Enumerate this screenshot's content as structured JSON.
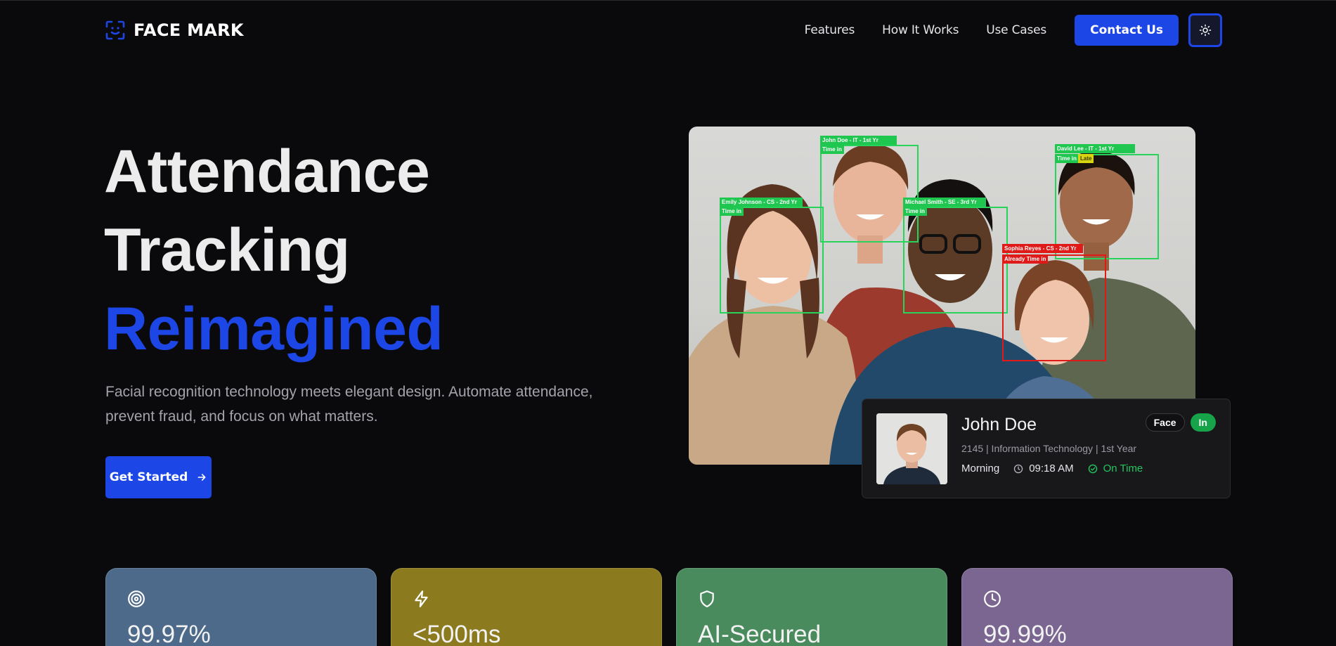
{
  "brand": {
    "name": "FACE MARK",
    "icon": "face-scan-icon",
    "accent": "#1d46e6"
  },
  "nav": {
    "links": [
      "Features",
      "How It Works",
      "Use Cases"
    ],
    "contact_label": "Contact Us",
    "theme_icon": "sun-icon"
  },
  "hero": {
    "line1": "Attendance",
    "line2": "Tracking",
    "line3": "Reimagined",
    "subtitle": "Facial recognition technology meets elegant design. Automate attendance, prevent fraud, and focus on what matters.",
    "cta_label": "Get Started"
  },
  "detections": [
    {
      "label": "John Doe - IT - 1st Yr",
      "status": "Time in",
      "color": "green"
    },
    {
      "label": "David Lee - IT - 1st Yr",
      "status": "Time in",
      "flag": "Late",
      "color": "green"
    },
    {
      "label": "Emily Johnson - CS - 2nd Yr",
      "status": "Time in",
      "color": "green"
    },
    {
      "label": "Michael Smith - SE - 3rd Yr",
      "status": "Time in",
      "color": "green"
    },
    {
      "label": "Sophia Reyes - CS - 2nd Yr",
      "status": "Already Time in",
      "color": "red"
    }
  ],
  "profile": {
    "name": "John Doe",
    "meta": "2145 | Information Technology | 1st Year",
    "session": "Morning",
    "time": "09:18 AM",
    "status": "On Time",
    "badge_method": "Face",
    "badge_state": "In"
  },
  "stats": [
    {
      "value": "99.97%",
      "icon": "target-icon",
      "color": "#4e6a8a"
    },
    {
      "value": "<500ms",
      "icon": "lightning-icon",
      "color": "#8c7a1f"
    },
    {
      "value": "AI-Secured",
      "icon": "shield-icon",
      "color": "#4a8b5e"
    },
    {
      "value": "99.99%",
      "icon": "clock-icon",
      "color": "#7a6690"
    }
  ]
}
